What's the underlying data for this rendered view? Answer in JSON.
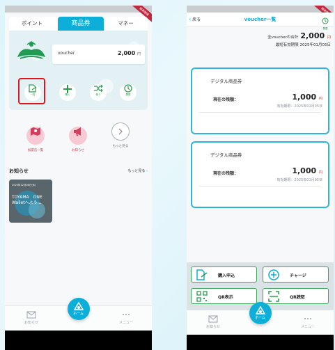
{
  "left": {
    "ribbon": "開発環境",
    "top_tabs": [
      {
        "label": "ポイント"
      },
      {
        "label": "商品券"
      },
      {
        "label": "マネー"
      }
    ],
    "voucher_card": {
      "label": "voucher",
      "amount": "2,000",
      "unit": "円"
    },
    "actions": [
      {
        "label": "一覧",
        "icon": "list-doc-icon"
      },
      {
        "label": "購入",
        "icon": "plus-icon"
      },
      {
        "label": "使う",
        "icon": "shuffle-icon"
      },
      {
        "label": "履歴",
        "icon": "history-icon"
      }
    ],
    "quick_links": [
      {
        "label": "加盟店一覧",
        "icon": "map-store-icon"
      },
      {
        "label": "お知らせ",
        "icon": "megaphone-icon"
      },
      {
        "label": "もっと見る",
        "icon": "chevron-right-icon"
      }
    ],
    "news_section": {
      "title": "お知らせ",
      "more": "もっと見る",
      "chevron": "›"
    },
    "news_card": {
      "date": "2025年12月08日(水)",
      "title": "TOYAMA　ONE Walletへよう…"
    }
  },
  "right": {
    "ribbon": "開発環境",
    "header": {
      "back": "戻る",
      "back_chevron": "‹",
      "title": "voucher一覧",
      "history": "履歴"
    },
    "summary": {
      "total_label": "全voucherの合計",
      "total_amount": "2,000",
      "unit": "円",
      "expiry_label": "最短有効期限 2025年01月05日"
    },
    "vouchers": [
      {
        "name": "デジタル商品券",
        "balance_label": "現在の残額：",
        "balance": "1,000",
        "unit": "円",
        "expiry": "有効期限：2025年01月05日"
      },
      {
        "name": "デジタル商品券",
        "balance_label": "現在の残額：",
        "balance": "1,000",
        "unit": "円",
        "expiry": "有効期限：2025年01月05日"
      }
    ],
    "actions": [
      {
        "label": "購入申込",
        "icon": "purchase-doc-icon"
      },
      {
        "label": "チャージ",
        "icon": "plus-circle-icon"
      },
      {
        "label": "QR表示",
        "icon": "qr-code-icon"
      },
      {
        "label": "QR読取",
        "icon": "qr-scan-icon"
      }
    ]
  },
  "bottom_tabs": [
    {
      "label": "お知らせ",
      "icon": "mail-icon"
    },
    {
      "label": "ホーム",
      "icon": "home-logo-icon"
    },
    {
      "label": "メニュー",
      "icon": "more-dots-icon"
    }
  ],
  "colors": {
    "accent": "#0dafd8",
    "highlight": "#e0141e",
    "green": "#3aa65a",
    "yen": "#cc3333"
  }
}
